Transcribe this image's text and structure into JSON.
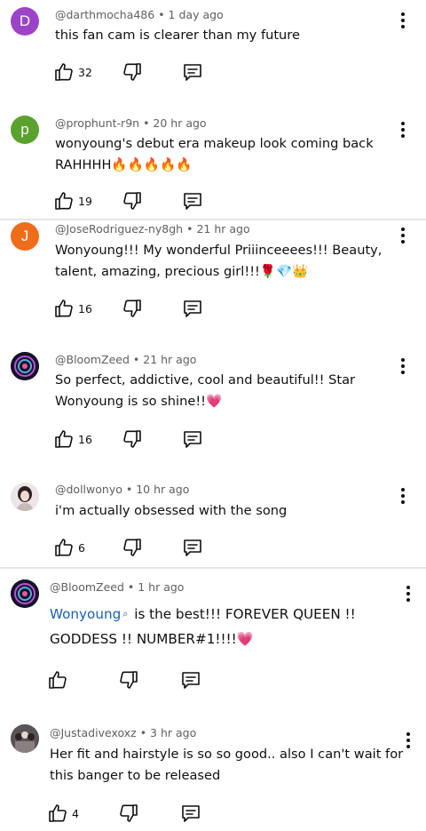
{
  "comments": [
    {
      "author": "@darthmocha486",
      "time": "1 day ago",
      "avatar_letter": "D",
      "avatar_color": "#9c44c8",
      "text_line1": "this fan cam is clearer than my future",
      "text_line2": "",
      "likes": "32"
    },
    {
      "author": "@prophunt-r9n",
      "time": "20 hr ago",
      "avatar_letter": "p",
      "avatar_color": "#5aa12e",
      "text_line1": "wonyoung's debut era makeup look coming back",
      "text_line2": "RAHHHH🔥🔥🔥🔥🔥",
      "likes": "19"
    },
    {
      "author": "@JoseRodriguez-ny8gh",
      "time": "21 hr ago",
      "avatar_letter": "J",
      "avatar_color": "#ef6c1a",
      "text_line1": "Wonyoung!!! My wonderful Priiinceeees!!! Beauty,",
      "text_line2": "talent, amazing, precious girl!!!🌹💎👑",
      "likes": "16"
    },
    {
      "author": "@BloomZeed",
      "time": "21 hr ago",
      "avatar_letter": "",
      "avatar_color": "#1a1a2e",
      "text_line1": "So perfect, addictive, cool and beautiful!! Star",
      "text_line2": "Wonyoung is so shine!!💗",
      "likes": "16"
    },
    {
      "author": "@dollwonyo",
      "time": "10 hr ago",
      "avatar_letter": "",
      "avatar_color": "#d8d0d0",
      "text_line1": "i'm actually obsessed with the song",
      "text_line2": "",
      "likes": "6"
    },
    {
      "author": "@BloomZeed",
      "time": "1 hr ago",
      "avatar_letter": "",
      "avatar_color": "#1a1a2e",
      "mention": "Wonyoung",
      "text_line1_rest": " is the best!!! FOREVER QUEEN !!",
      "text_line2": "GODDESS !! NUMBER#1!!!!💗",
      "likes": ""
    },
    {
      "author": "@Justadivexoxz",
      "time": "3 hr ago",
      "avatar_letter": "",
      "avatar_color": "#6a6a6a",
      "text_line1": "Her fit and hairstyle is so so good.. also I can't wait for",
      "text_line2": "this banger to be released",
      "likes": "4"
    }
  ],
  "meta_separator": "•"
}
